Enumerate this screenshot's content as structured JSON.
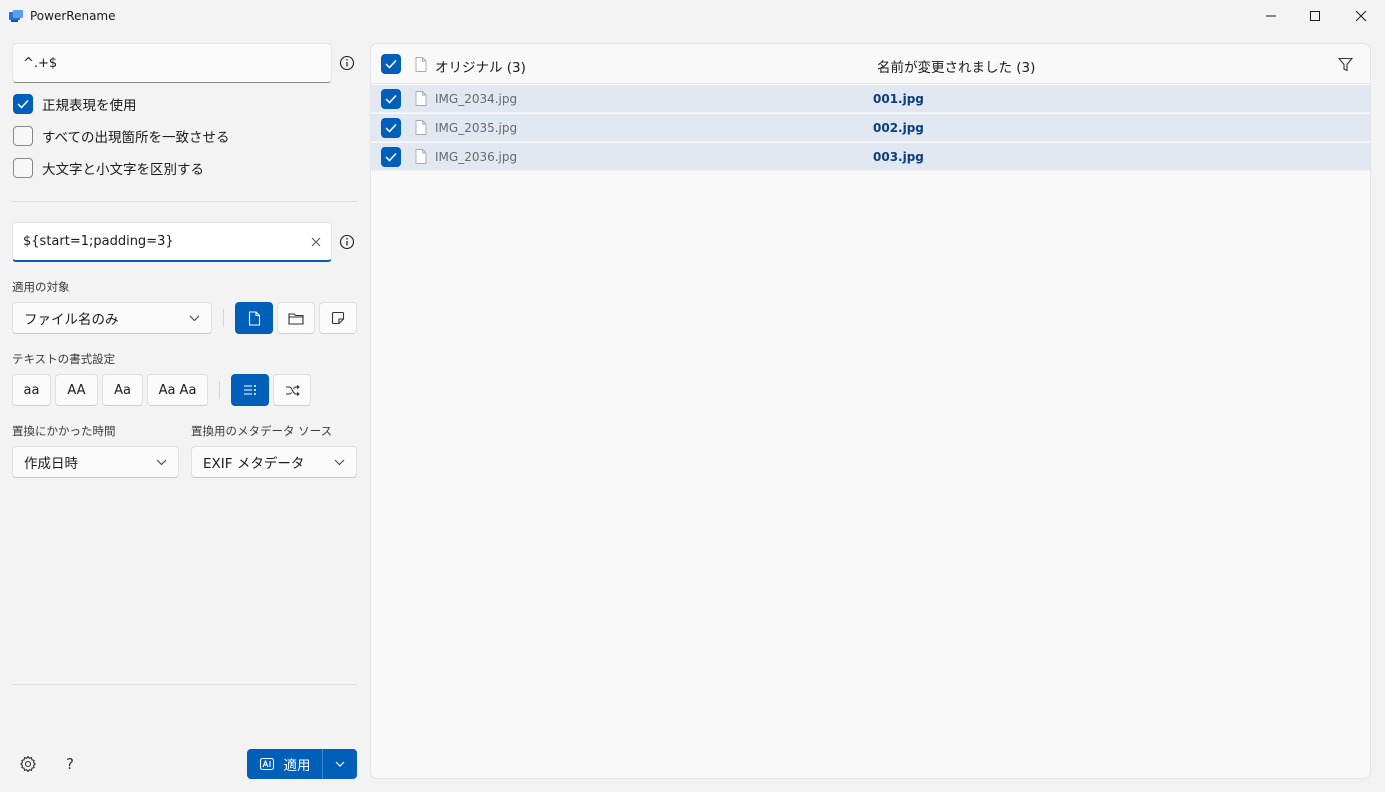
{
  "window": {
    "title": "PowerRename"
  },
  "search": {
    "value": "^.+$"
  },
  "options": {
    "use_regex": {
      "label": "正規表現を使用",
      "checked": true
    },
    "match_all": {
      "label": "すべての出現箇所を一致させる",
      "checked": false
    },
    "case_sensitive": {
      "label": "大文字と小文字を区別する",
      "checked": false
    }
  },
  "replace": {
    "value": "${start=1;padding=3}"
  },
  "apply_to": {
    "label": "適用の対象",
    "selected": "ファイル名のみ"
  },
  "text_format": {
    "label": "テキストの書式設定",
    "lowercase": "aa",
    "uppercase": "AA",
    "titlecase": "Aa",
    "capitalize": "Aa Aa"
  },
  "time_used": {
    "label": "置換にかかった時間",
    "selected": "作成日時"
  },
  "metadata_source": {
    "label": "置換用のメタデータ ソース",
    "selected": "EXIF メタデータ"
  },
  "footer": {
    "help_label": "?",
    "apply_label": "適用"
  },
  "list": {
    "original_header": "オリジナル (3)",
    "renamed_header": "名前が変更されました (3)",
    "rows": [
      {
        "original": "IMG_2034.jpg",
        "renamed": "001.jpg",
        "checked": true
      },
      {
        "original": "IMG_2035.jpg",
        "renamed": "002.jpg",
        "checked": true
      },
      {
        "original": "IMG_2036.jpg",
        "renamed": "003.jpg",
        "checked": true
      }
    ]
  },
  "colors": {
    "accent": "#005fb8",
    "row_highlight": "#e1e8f1",
    "renamed_text": "#0b3d80"
  }
}
